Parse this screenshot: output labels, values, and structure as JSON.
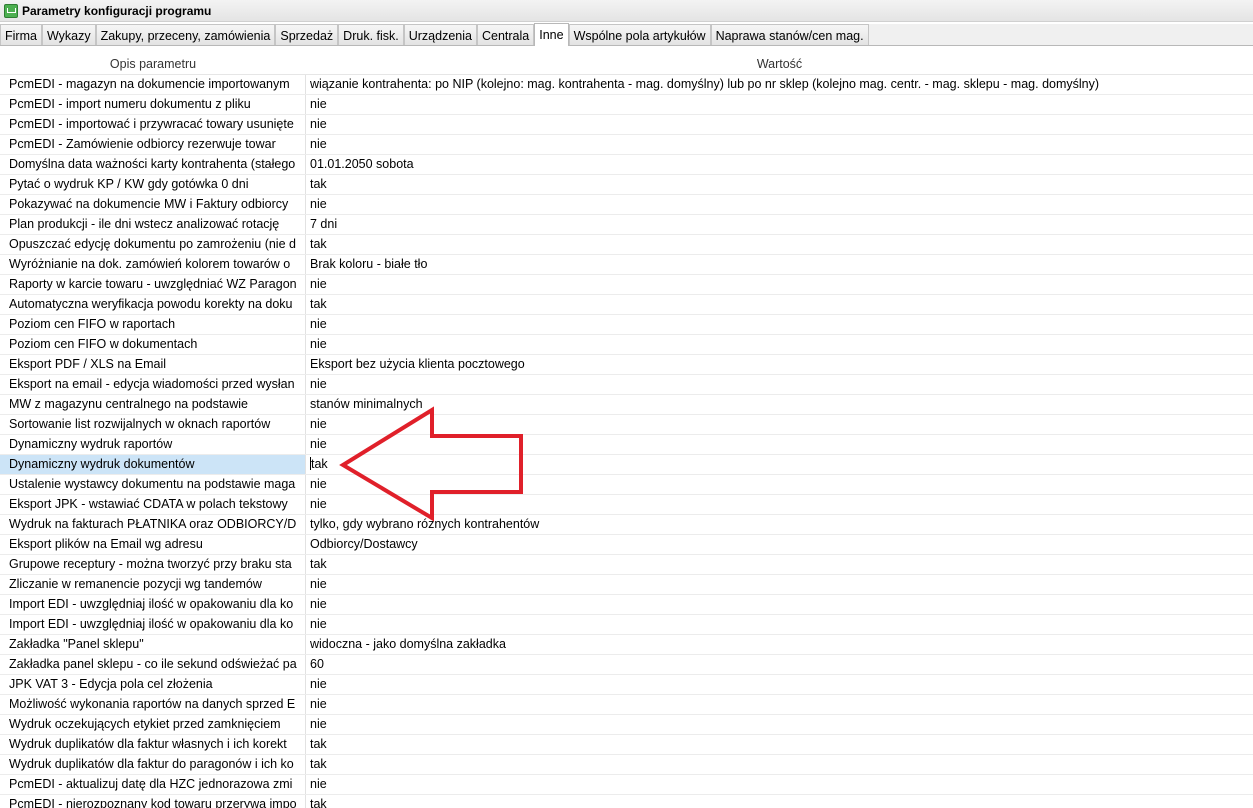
{
  "window": {
    "title": "Parametry konfiguracji programu"
  },
  "tabs": [
    {
      "label": "Firma",
      "active": false
    },
    {
      "label": "Wykazy",
      "active": false
    },
    {
      "label": "Zakupy, przeceny, zamówienia",
      "active": false
    },
    {
      "label": "Sprzedaż",
      "active": false
    },
    {
      "label": "Druk. fisk.",
      "active": false
    },
    {
      "label": "Urządzenia",
      "active": false
    },
    {
      "label": "Centrala",
      "active": false
    },
    {
      "label": "Inne",
      "active": true
    },
    {
      "label": "Wspólne pola artykułów",
      "active": false
    },
    {
      "label": "Naprawa stanów/cen mag.",
      "active": false
    }
  ],
  "grid": {
    "headers": {
      "description": "Opis parametru",
      "value": "Wartość"
    },
    "selected_row": 20,
    "rows": [
      {
        "desc": "PcmEDI - magazyn na dokumencie importowanym",
        "value": "wiązanie kontrahenta: po NIP (kolejno: mag. kontrahenta - mag. domyślny) lub po nr sklep (kolejno mag. centr. - mag. sklepu - mag. domyślny)"
      },
      {
        "desc": "PcmEDI - import numeru dokumentu z pliku",
        "value": "nie"
      },
      {
        "desc": "PcmEDI - importować i przywracać towary usunięte",
        "value": "nie"
      },
      {
        "desc": "PcmEDI - Zamówienie odbiorcy rezerwuje towar",
        "value": "nie"
      },
      {
        "desc": "Domyślna data ważności karty kontrahenta (stałego",
        "value": "01.01.2050 sobota"
      },
      {
        "desc": "Pytać o wydruk KP / KW gdy gotówka 0 dni",
        "value": "tak"
      },
      {
        "desc": "Pokazywać na dokumencie MW i Faktury odbiorcy",
        "value": "nie"
      },
      {
        "desc": "Plan produkcji - ile dni wstecz analizować rotację",
        "value": "7 dni"
      },
      {
        "desc": "Opuszczać edycję dokumentu po zamrożeniu (nie d",
        "value": "tak"
      },
      {
        "desc": "Wyróżnianie na dok. zamówień kolorem towarów o",
        "value": "Brak koloru - białe tło"
      },
      {
        "desc": "Raporty w karcie towaru - uwzględniać WZ Paragon",
        "value": "nie"
      },
      {
        "desc": "Automatyczna weryfikacja powodu korekty na doku",
        "value": "tak"
      },
      {
        "desc": "Poziom cen FIFO w raportach",
        "value": "nie"
      },
      {
        "desc": "Poziom cen FIFO w dokumentach",
        "value": "nie"
      },
      {
        "desc": "Eksport PDF / XLS na Email",
        "value": "Eksport bez użycia klienta pocztowego"
      },
      {
        "desc": "Eksport na email - edycja wiadomości przed wysłan",
        "value": "nie"
      },
      {
        "desc": "MW z magazynu centralnego na podstawie",
        "value": "stanów minimalnych"
      },
      {
        "desc": "Sortowanie list rozwijalnych w oknach raportów",
        "value": "nie"
      },
      {
        "desc": "Dynamiczny wydruk raportów",
        "value": "nie"
      },
      {
        "desc": "Dynamiczny wydruk dokumentów",
        "value": "tak"
      },
      {
        "desc": "Ustalenie wystawcy dokumentu na podstawie maga",
        "value": "nie"
      },
      {
        "desc": "Eksport JPK - wstawiać CDATA w polach tekstowy",
        "value": "nie"
      },
      {
        "desc": "Wydruk na fakturach PŁATNIKA oraz ODBIORCY/D",
        "value": "tylko, gdy wybrano różnych kontrahentów"
      },
      {
        "desc": "Eksport plików na Email wg adresu",
        "value": "Odbiorcy/Dostawcy"
      },
      {
        "desc": "Grupowe receptury - można tworzyć przy braku sta",
        "value": "tak"
      },
      {
        "desc": "Zliczanie w remanencie pozycji wg tandemów",
        "value": "nie"
      },
      {
        "desc": "Import EDI - uwzględniaj ilość w opakowaniu dla ko",
        "value": "nie"
      },
      {
        "desc": "Import EDI - uwzględniaj ilość w opakowaniu dla ko",
        "value": "nie"
      },
      {
        "desc": "Zakładka \"Panel sklepu\"",
        "value": "widoczna - jako domyślna zakładka"
      },
      {
        "desc": "Zakładka panel sklepu - co ile sekund odświeżać pa",
        "value": "60"
      },
      {
        "desc": "JPK VAT 3 - Edycja pola cel złożenia",
        "value": "nie"
      },
      {
        "desc": "Możliwość wykonania raportów na danych sprzed E",
        "value": "nie"
      },
      {
        "desc": "Wydruk oczekujących etykiet przed zamknięciem",
        "value": "nie"
      },
      {
        "desc": "Wydruk duplikatów dla faktur własnych i ich korekt",
        "value": "tak"
      },
      {
        "desc": "Wydruk duplikatów dla faktur do paragonów i ich ko",
        "value": "tak"
      },
      {
        "desc": "PcmEDI - aktualizuj datę dla HZC jednorazowa zmi",
        "value": "nie"
      },
      {
        "desc": "PcmEDI - nierozpoznany kod towaru przerywa impo",
        "value": "tak"
      }
    ]
  },
  "annotation": {
    "arrow_color": "#e0202a"
  }
}
